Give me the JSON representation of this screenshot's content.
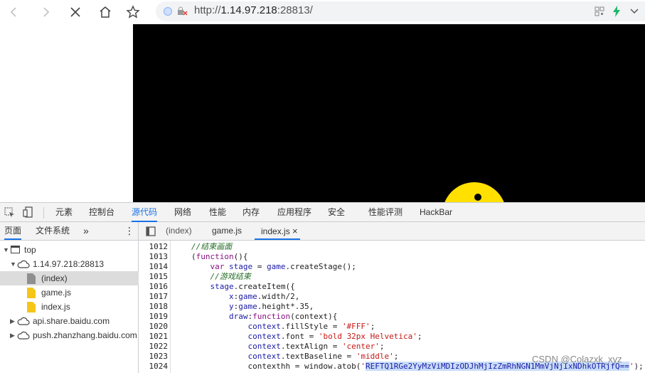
{
  "browser": {
    "url_scheme": "http://",
    "url_host": "1.14.97.218",
    "url_port": ":28813/"
  },
  "devtools": {
    "tabs": [
      "元素",
      "控制台",
      "源代码",
      "网络",
      "性能",
      "内存",
      "应用程序",
      "安全",
      "性能评测",
      "HackBar"
    ],
    "active_tab": "源代码",
    "navigator_tabs": [
      "页面",
      "文件系统"
    ],
    "more_glyph": "»",
    "menu_glyph": "⋮",
    "editor_tabs": [
      "(index)",
      "game.js",
      "index.js"
    ],
    "close_glyph": "×",
    "tree": {
      "root": "top",
      "host": "1.14.97.218:28813",
      "files": [
        "(index)",
        "game.js",
        "index.js"
      ],
      "others": [
        "api.share.baidu.com",
        "push.zhanzhang.baidu.com"
      ]
    },
    "line_numbers": [
      "1012",
      "1013",
      "1014",
      "1015",
      "1016",
      "1017",
      "1018",
      "1019",
      "1020",
      "1021",
      "1022",
      "1023",
      "1024"
    ]
  },
  "watermark": "CSDN @Colazxk_xyz"
}
